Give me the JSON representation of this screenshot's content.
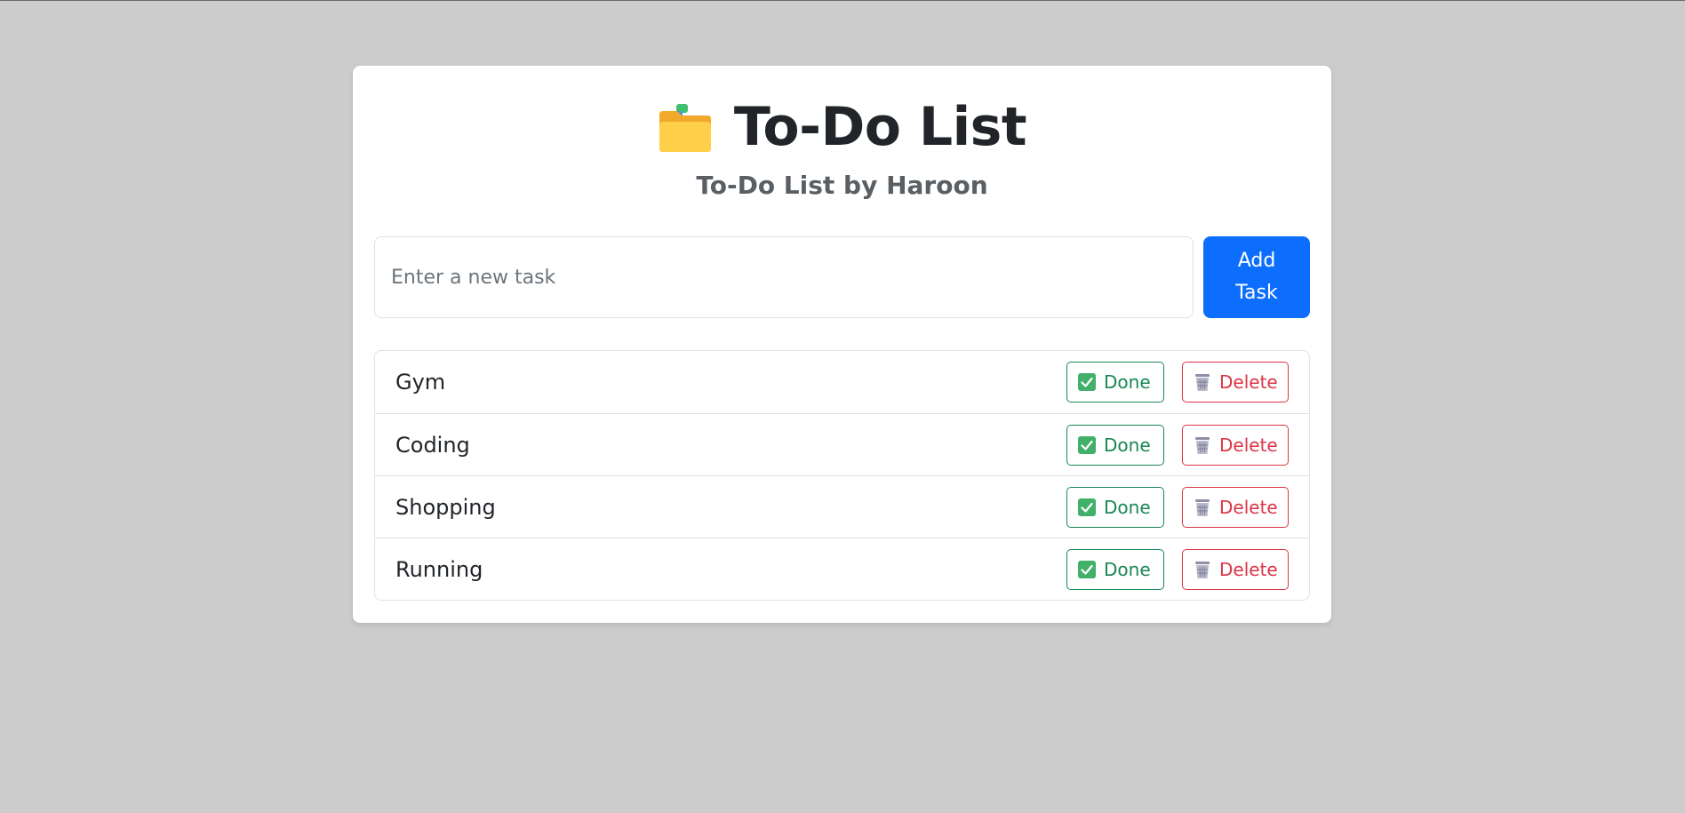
{
  "app": {
    "title": "To-Do List",
    "title_icon": "card-index-dividers-icon",
    "subtitle": "To-Do List by Haroon"
  },
  "form": {
    "input_value": "",
    "input_placeholder": "Enter a new task",
    "add_button_label": "Add Task"
  },
  "colors": {
    "page_background": "#cccccc",
    "primary": "#0d6efd",
    "success": "#198754",
    "danger": "#dc3545"
  },
  "tasks": [
    {
      "label": "Gym",
      "done_label": "Done",
      "delete_label": "Delete",
      "done_icon": "check-box-icon",
      "delete_icon": "wastebasket-icon"
    },
    {
      "label": "Coding",
      "done_label": "Done",
      "delete_label": "Delete",
      "done_icon": "check-box-icon",
      "delete_icon": "wastebasket-icon"
    },
    {
      "label": "Shopping",
      "done_label": "Done",
      "delete_label": "Delete",
      "done_icon": "check-box-icon",
      "delete_icon": "wastebasket-icon"
    },
    {
      "label": "Running",
      "done_label": "Done",
      "delete_label": "Delete",
      "done_icon": "check-box-icon",
      "delete_icon": "wastebasket-icon"
    }
  ]
}
